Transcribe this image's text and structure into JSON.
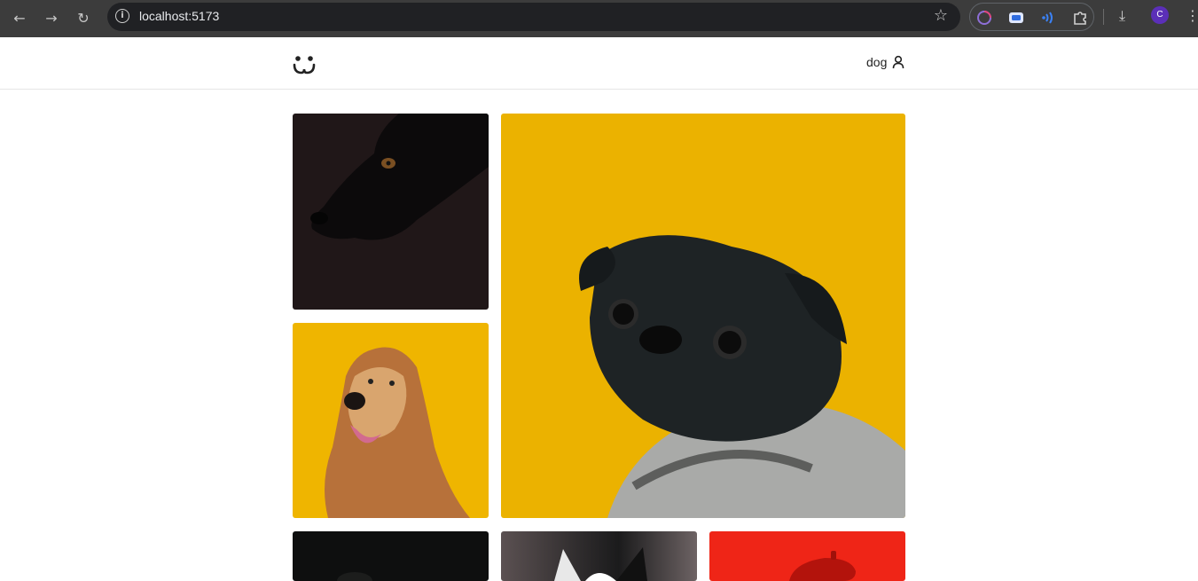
{
  "browser": {
    "url": "localhost:5173",
    "profile_initial": "C"
  },
  "app": {
    "username": "dog"
  },
  "gallery": [
    {
      "name": "black-dog-photo"
    },
    {
      "name": "afghan-hound-photo"
    },
    {
      "name": "pug-photo"
    },
    {
      "name": "dark-dog-photo"
    },
    {
      "name": "french-bulldog-photo"
    },
    {
      "name": "red-beret-dog-photo"
    }
  ],
  "colors": {
    "chrome_bg": "#3c3c3c",
    "omnibox_bg": "#202124",
    "yellow_backdrop": "#ebb200",
    "red_backdrop": "#ef2517"
  }
}
